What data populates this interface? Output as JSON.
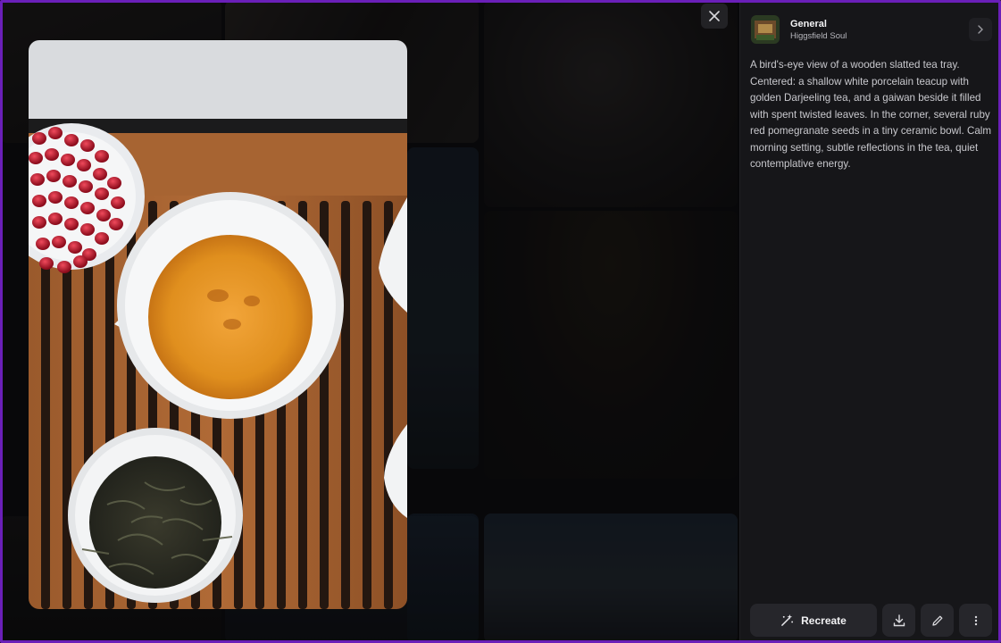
{
  "viewer": {
    "close_icon": "close-icon"
  },
  "panel": {
    "title": "General",
    "subtitle": "Higgsfield Soul",
    "description": "A bird's-eye view of a wooden slatted tea tray. Centered: a shallow white porcelain teacup with golden Darjeeling tea, and a gaiwan beside it filled with spent twisted leaves. In the corner, several ruby red pomegranate seeds in a tiny ceramic bowl. Calm morning setting, subtle reflections in the tea, quiet contemplative energy.",
    "recreate_label": "Recreate",
    "icons": [
      "chevron-right-icon",
      "magic-wand-icon",
      "download-icon",
      "pencil-icon",
      "more-vertical-icon"
    ]
  },
  "colors": {
    "accent_border": "#6a1fb8",
    "panel_bg": "#161619",
    "button_bg": "#26262b"
  }
}
